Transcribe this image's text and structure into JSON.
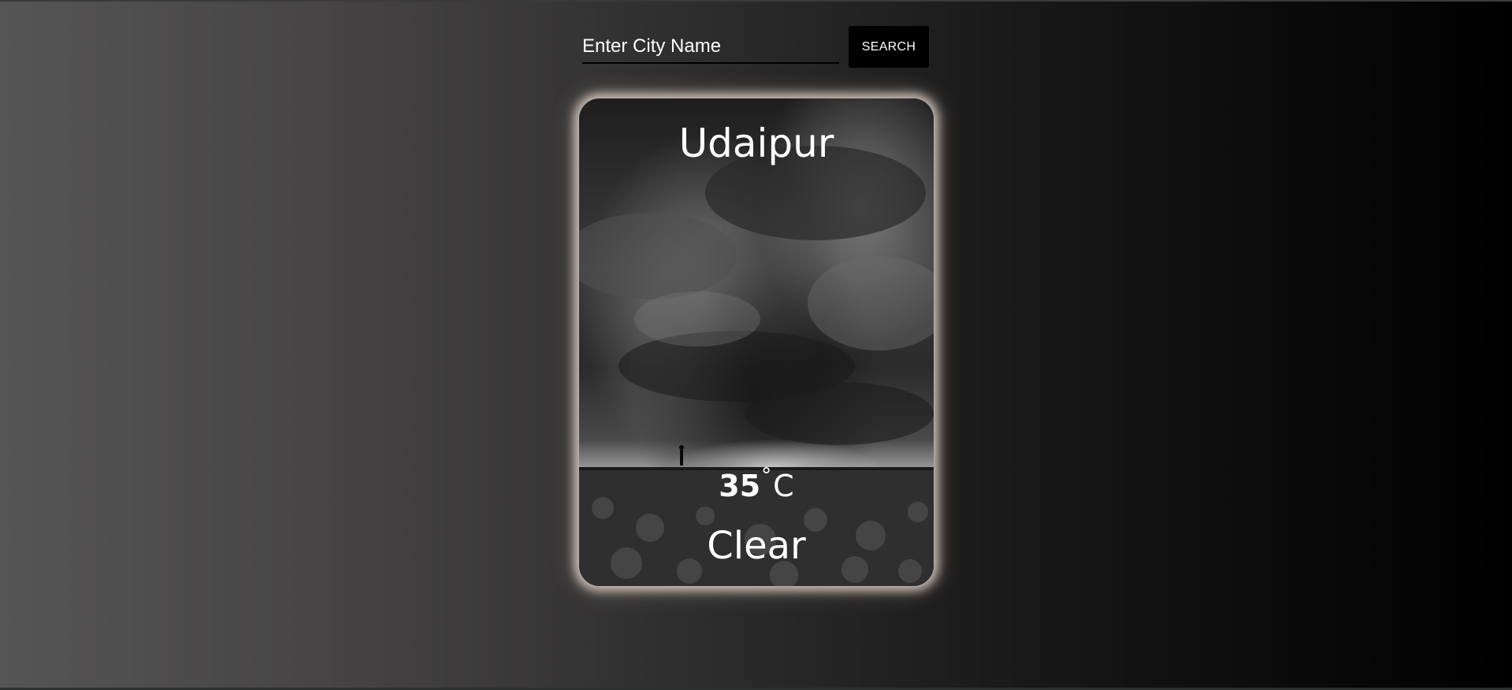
{
  "search": {
    "placeholder": "Enter City Name",
    "value": "",
    "button_label": "SEARCH"
  },
  "weather": {
    "city": "Udaipur",
    "temperature": "35",
    "degree_symbol": "°",
    "unit": "C",
    "condition": "Clear"
  },
  "background_image": "stormy-sky-field-grayscale",
  "colors": {
    "text": "#ffffff",
    "button_bg": "#000000",
    "card_glow": "#f0e1d7",
    "page_gradient_left": "#565555",
    "page_gradient_right": "#000000"
  }
}
